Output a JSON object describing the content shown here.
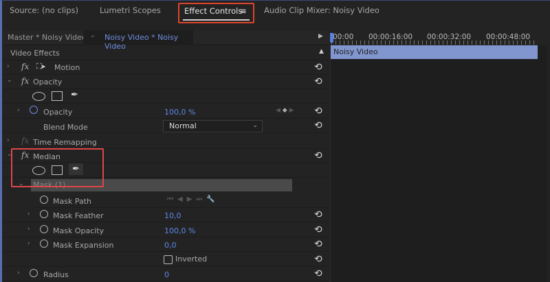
{
  "tabs": {
    "source": "Source: (no clips)",
    "lumetri": "Lumetri Scopes",
    "effect_controls": "Effect Controls",
    "menu_icon": "≡",
    "audio_mixer": "Audio Clip Mixer: Noisy Video"
  },
  "header": {
    "master": "Master * Noisy Video",
    "clip": "Noisy Video * Noisy Video"
  },
  "timeline": {
    "ticks": [
      "00:00",
      "00:00:16:00",
      "00:00:32:00",
      "00:00:48:00"
    ],
    "clip_name": "Noisy Video",
    "clip_color": "#8196cf"
  },
  "effects": {
    "section": "Video Effects",
    "motion": "Motion",
    "opacity": "Opacity",
    "opacity_prop": {
      "label": "Opacity",
      "value": "100,0 %"
    },
    "blend": {
      "label": "Blend Mode",
      "value": "Normal"
    },
    "time_remap": "Time Remapping",
    "median": "Median",
    "mask": "Mask (1)",
    "mask_path": "Mask Path",
    "mask_feather": {
      "label": "Mask Feather",
      "value": "10,0"
    },
    "mask_opacity": {
      "label": "Mask Opacity",
      "value": "100,0 %"
    },
    "mask_expansion": {
      "label": "Mask Expansion",
      "value": "0,0"
    },
    "inverted": "Inverted",
    "radius": {
      "label": "Radius",
      "value": "0"
    }
  },
  "colors": {
    "accent": "#5d87e6",
    "highlight": "#e0452c"
  }
}
